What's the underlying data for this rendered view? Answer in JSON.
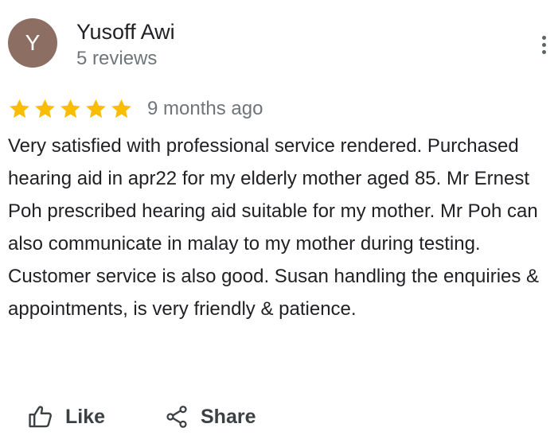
{
  "reviewer": {
    "initial": "Y",
    "name": "Yusoff Awi",
    "review_count": "5 reviews",
    "avatar_color": "#8d6e63"
  },
  "rating": {
    "stars": 5,
    "max_stars": 5,
    "star_color": "#fbbc04",
    "date": "9 months ago"
  },
  "review": {
    "text": "Very satisfied with professional service rendered. Purchased hearing aid in apr22 for my elderly mother aged 85. Mr Ernest Poh prescribed hearing aid suitable for my mother. Mr Poh can also communicate in malay to my mother during testing. Customer service is also good. Susan handling the enquiries & appointments, is very friendly & patience."
  },
  "actions": {
    "like_label": "Like",
    "share_label": "Share",
    "like_icon": "thumbs-up-icon",
    "share_icon": "share-icon",
    "more_icon": "more-vertical-icon"
  }
}
